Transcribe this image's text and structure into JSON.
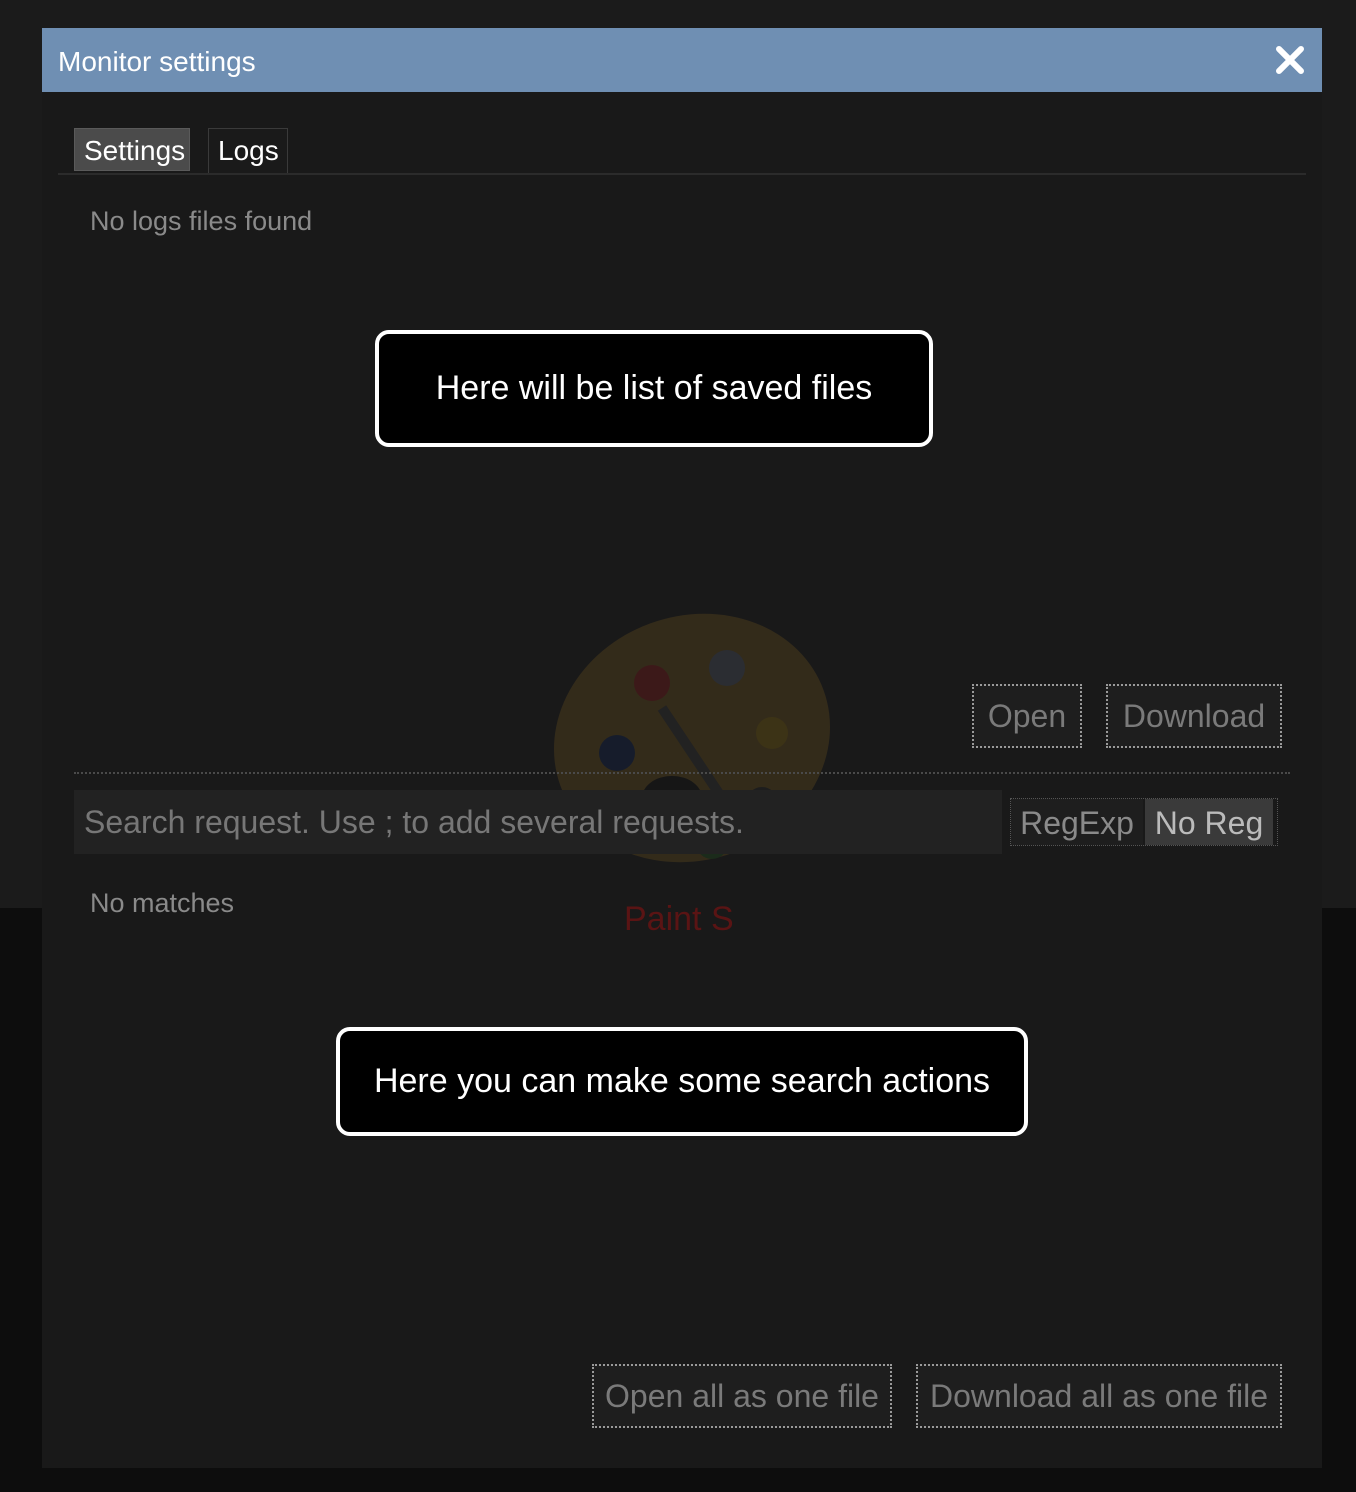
{
  "dialog": {
    "title": "Monitor settings"
  },
  "tabs": [
    {
      "label": "Settings",
      "active": false
    },
    {
      "label": "Logs",
      "active": true
    }
  ],
  "logs": {
    "empty_text": "No logs files found",
    "open_label": "Open",
    "download_label": "Download"
  },
  "callouts": {
    "files": "Here will be list of saved files",
    "search": "Here you can make some search actions"
  },
  "search": {
    "placeholder": "Search request. Use ; to add several requests.",
    "value": "",
    "mode_options": [
      "RegExp",
      "No Reg"
    ],
    "selected_mode": "No Reg",
    "empty_text": "No matches"
  },
  "footer": {
    "open_all_label": "Open all as one file",
    "download_all_label": "Download all as one file"
  },
  "watermark": {
    "text": "Paint S"
  },
  "colors": {
    "titlebar": "#6f8fb3",
    "panel": "#191919",
    "text_muted": "#8a8a8a"
  },
  "icons": {
    "close": "close-icon",
    "watermark": "palette-icon"
  }
}
